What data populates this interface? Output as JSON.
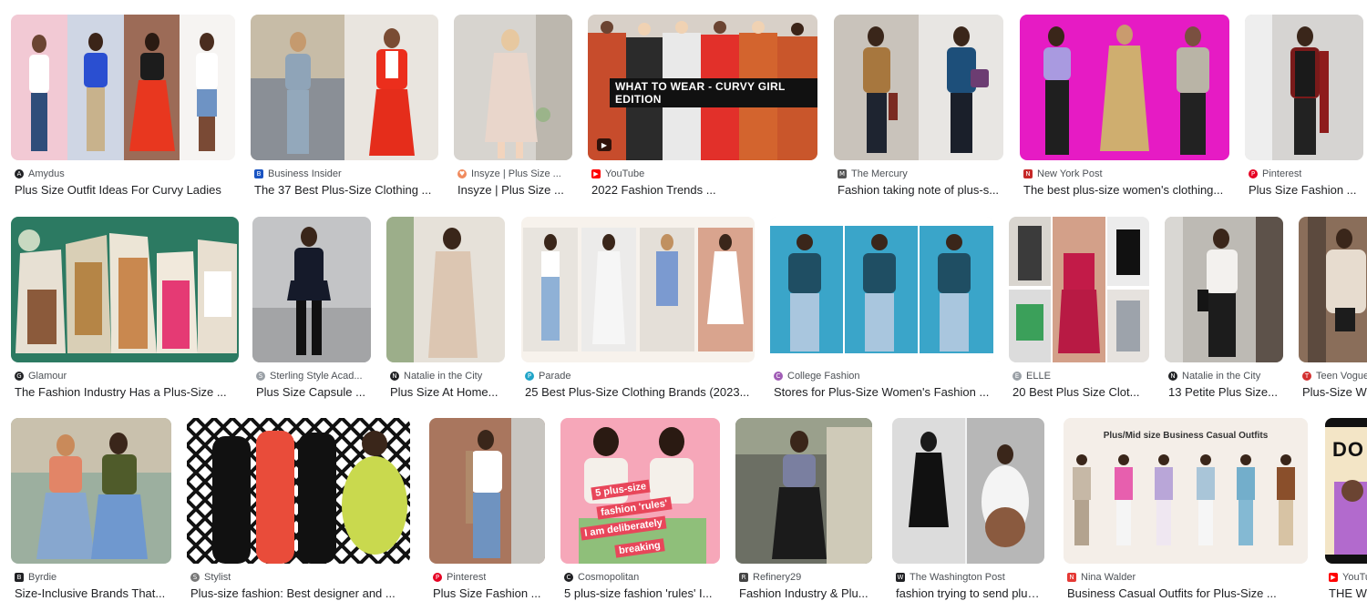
{
  "results": [
    {
      "source": "Amydus",
      "title": "Plus Size Outfit Ideas For Curvy Ladies",
      "fav_color": "#202124",
      "fav_char": "A"
    },
    {
      "source": "Business Insider",
      "title": "The 37 Best Plus-Size Clothing ...",
      "fav_color": "#1a54c2",
      "fav_char": "B"
    },
    {
      "source": "Insyze | Plus Size ...",
      "title": "Insyze | Plus Size ...",
      "fav_color": "#f08a5d",
      "fav_char": "♥"
    },
    {
      "source": "YouTube",
      "title": "2022 Fashion Trends ...",
      "fav_color": "#ff0000",
      "fav_char": "▶",
      "overlay": "WHAT TO WEAR - CURVY GIRL EDITION"
    },
    {
      "source": "The Mercury",
      "title": "Fashion taking note of plus-s...",
      "fav_color": "#555555",
      "fav_char": "M"
    },
    {
      "source": "New York Post",
      "title": "The best plus-size women's clothing...",
      "fav_color": "#c62828",
      "fav_char": "N"
    },
    {
      "source": "Pinterest",
      "title": "Plus Size Fashion ...",
      "fav_color": "#e60023",
      "fav_char": "P"
    },
    {
      "source": "Glamour",
      "title": "The Fashion Industry Has a Plus-Size ...",
      "fav_color": "#202124",
      "fav_char": "G"
    },
    {
      "source": "Sterling Style Acad...",
      "title": "Plus Size Capsule ...",
      "fav_color": "#9aa0a6",
      "fav_char": "S"
    },
    {
      "source": "Natalie in the City",
      "title": "Plus Size At Home...",
      "fav_color": "#202124",
      "fav_char": "N"
    },
    {
      "source": "Parade",
      "title": "25 Best Plus-Size Clothing Brands (2023...",
      "fav_color": "#20a4c8",
      "fav_char": "P"
    },
    {
      "source": "College Fashion",
      "title": "Stores for Plus-Size Women's Fashion ...",
      "fav_color": "#a05cb5",
      "fav_char": "C"
    },
    {
      "source": "ELLE",
      "title": "20 Best Plus Size Clot...",
      "fav_color": "#9aa0a6",
      "fav_char": "E"
    },
    {
      "source": "Natalie in the City",
      "title": "13 Petite Plus Size...",
      "fav_color": "#202124",
      "fav_char": "N"
    },
    {
      "source": "Teen Vogue",
      "title": "Plus-Size W",
      "fav_color": "#d32f2f",
      "fav_char": "T"
    },
    {
      "source": "Byrdie",
      "title": "Size-Inclusive Brands That...",
      "fav_color": "#202124",
      "fav_char": "B"
    },
    {
      "source": "Stylist",
      "title": "Plus-size fashion: Best designer and ...",
      "fav_color": "#777777",
      "fav_char": "S"
    },
    {
      "source": "Pinterest",
      "title": "Plus Size Fashion ...",
      "fav_color": "#e60023",
      "fav_char": "P"
    },
    {
      "source": "Cosmopolitan",
      "title": "5 plus-size fashion 'rules' I...",
      "fav_color": "#202124",
      "fav_char": "C",
      "overlay_lines": [
        "5 plus-size",
        "fashion 'rules'",
        "I am deliberately",
        "breaking"
      ]
    },
    {
      "source": "Refinery29",
      "title": "Fashion Industry & Plu...",
      "fav_color": "#444444",
      "fav_char": "R"
    },
    {
      "source": "The Washington Post",
      "title": "fashion trying to send plus-...",
      "fav_color": "#202124",
      "fav_char": "W"
    },
    {
      "source": "Nina Walder",
      "title": "Business Casual Outfits for Plus-Size ...",
      "fav_color": "#e53935",
      "fav_char": "N",
      "overlay": "Plus/Mid size Business Casual Outfits"
    },
    {
      "source": "YouTu",
      "title": "THE WO",
      "fav_color": "#ff0000",
      "fav_char": "▶",
      "overlay": "DO"
    }
  ],
  "colors": {
    "source_text": "#4d5156",
    "title_text": "#202124",
    "thumb_bg": "#f1f3f4"
  }
}
